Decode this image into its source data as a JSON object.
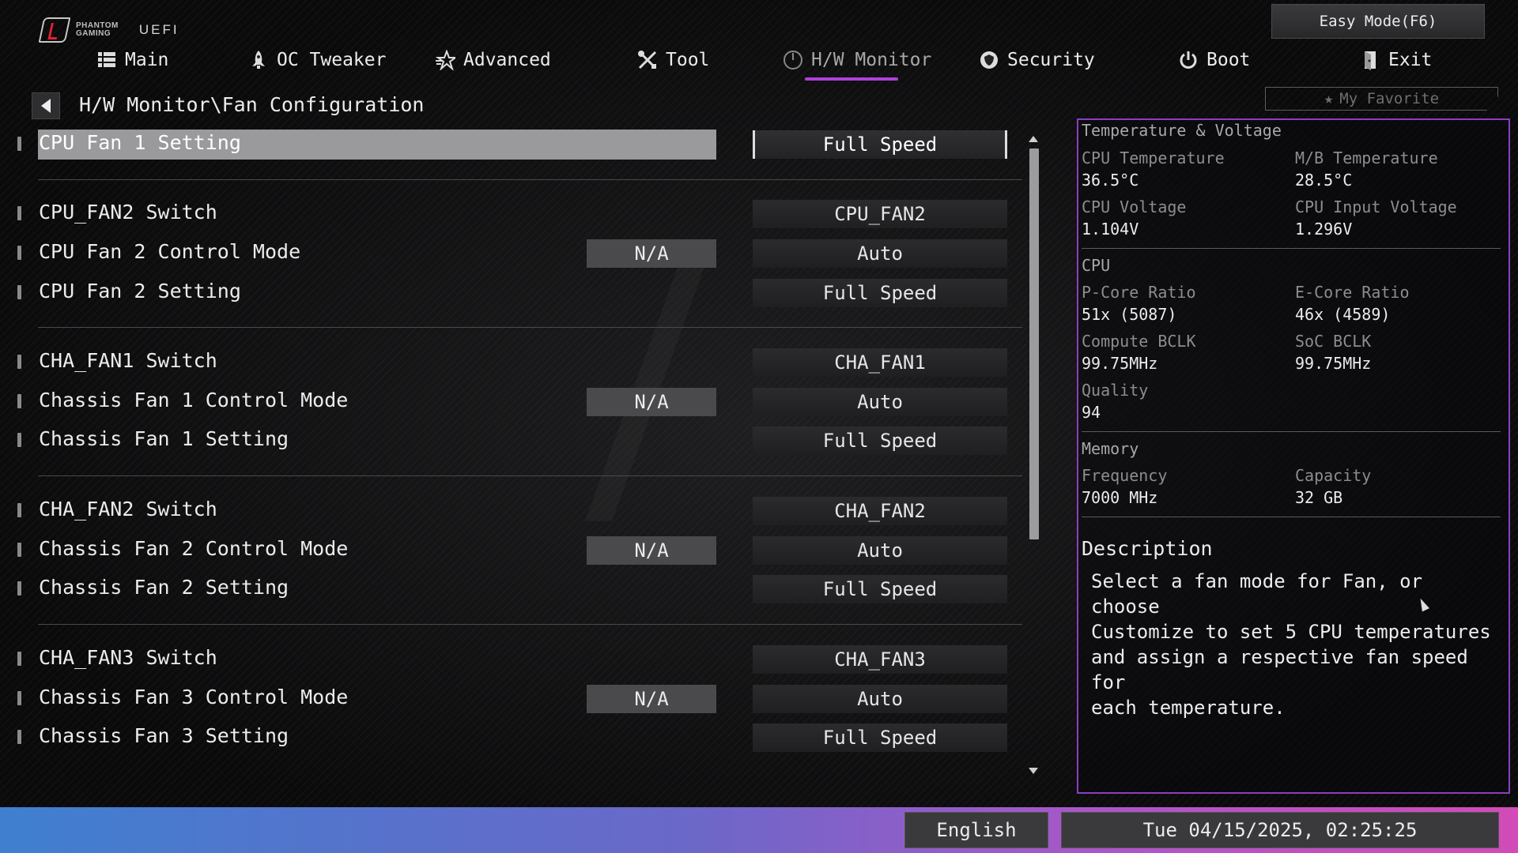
{
  "brand": {
    "line1": "PHANTOM",
    "line2": "GAMING",
    "uefi": "UEFI"
  },
  "easy_mode": "Easy Mode(F6)",
  "nav": [
    {
      "label": "Main",
      "icon": "list-icon"
    },
    {
      "label": "OC Tweaker",
      "icon": "rocket-icon"
    },
    {
      "label": "Advanced",
      "icon": "star-icon"
    },
    {
      "label": "Tool",
      "icon": "tools-icon"
    },
    {
      "label": "H/W Monitor",
      "icon": "monitor-icon",
      "active": true
    },
    {
      "label": "Security",
      "icon": "shield-icon"
    },
    {
      "label": "Boot",
      "icon": "power-icon"
    },
    {
      "label": "Exit",
      "icon": "exit-door-icon"
    }
  ],
  "breadcrumb": "H/W Monitor\\Fan Configuration",
  "favorite": "My Favorite",
  "settings": [
    {
      "label": "CPU Fan 1 Setting",
      "value": "Full Speed",
      "selected": true
    },
    {
      "label": "CPU_FAN2 Switch",
      "value": "CPU_FAN2"
    },
    {
      "label": "CPU Fan 2 Control Mode",
      "na": "N/A",
      "value": "Auto"
    },
    {
      "label": "CPU Fan 2 Setting",
      "value": "Full Speed"
    },
    {
      "label": "CHA_FAN1 Switch",
      "value": "CHA_FAN1"
    },
    {
      "label": "Chassis Fan 1 Control Mode",
      "na": "N/A",
      "value": "Auto"
    },
    {
      "label": "Chassis Fan 1 Setting",
      "value": "Full Speed"
    },
    {
      "label": "CHA_FAN2 Switch",
      "value": "CHA_FAN2"
    },
    {
      "label": "Chassis Fan 2 Control Mode",
      "na": "N/A",
      "value": "Auto"
    },
    {
      "label": "Chassis Fan 2 Setting",
      "value": "Full Speed"
    },
    {
      "label": "CHA_FAN3 Switch",
      "value": "CHA_FAN3"
    },
    {
      "label": "Chassis Fan 3 Control Mode",
      "na": "N/A",
      "value": "Auto"
    },
    {
      "label": "Chassis Fan 3 Setting",
      "value": "Full Speed"
    }
  ],
  "panel": {
    "temp_volt": {
      "title": "Temperature & Voltage",
      "cpu_temp_label": "CPU Temperature",
      "cpu_temp": "36.5°C",
      "mb_temp_label": "M/B Temperature",
      "mb_temp": "28.5°C",
      "cpu_volt_label": "CPU Voltage",
      "cpu_volt": "1.104V",
      "cpu_in_volt_label": "CPU Input Voltage",
      "cpu_in_volt": "1.296V"
    },
    "cpu": {
      "title": "CPU",
      "pcore_label": "P-Core Ratio",
      "pcore": "51x (5087)",
      "ecore_label": "E-Core Ratio",
      "ecore": "46x (4589)",
      "bclk_label": "Compute BCLK",
      "bclk": "99.75MHz",
      "soc_label": "SoC BCLK",
      "soc": "99.75MHz",
      "quality_label": "Quality",
      "quality": "94"
    },
    "memory": {
      "title": "Memory",
      "freq_label": "Frequency",
      "freq": "7000 MHz",
      "cap_label": "Capacity",
      "cap": "32 GB"
    },
    "description_title": "Description",
    "description": "Select a fan mode for Fan, or choose\nCustomize to set 5 CPU temperatures\nand assign a respective fan speed for\neach temperature."
  },
  "footer": {
    "language": "English",
    "datetime": "Tue 04/15/2025, 02:25:25"
  },
  "colors": {
    "accent": "#8b3fc0",
    "selected_row": "#9a9a9c",
    "bar_start": "#3f7fd0",
    "bar_end": "#d24bb8"
  }
}
